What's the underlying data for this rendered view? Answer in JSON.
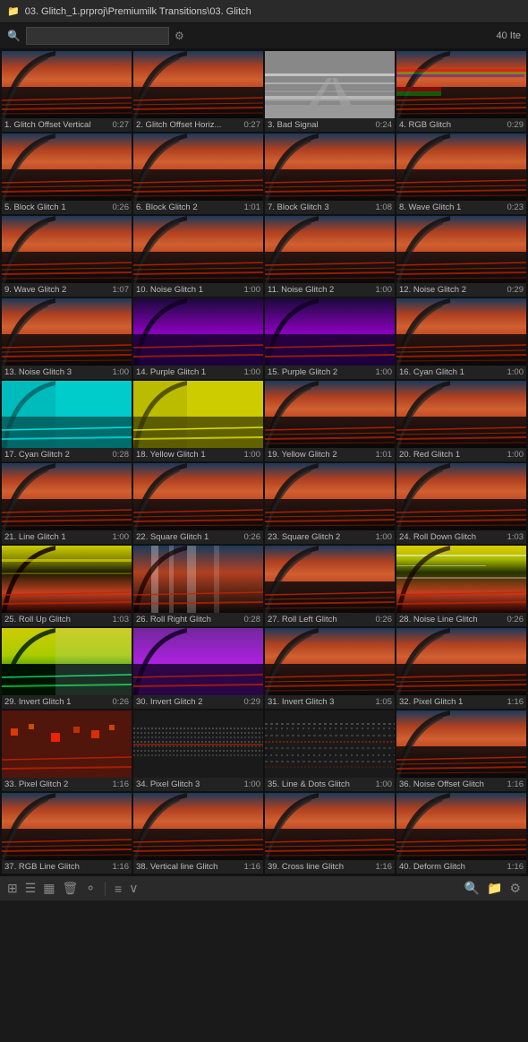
{
  "header": {
    "icon": "📁",
    "title": "03. Glitch_1.prproj\\Premiumilk Transitions\\03. Glitch"
  },
  "search": {
    "placeholder": "",
    "value": ""
  },
  "item_count": "40 Ite",
  "items": [
    {
      "id": 1,
      "name": "1. Glitch Offset Vertical",
      "time": "0:27",
      "type": "base"
    },
    {
      "id": 2,
      "name": "2. Glitch Offset Horiz...",
      "time": "0:27",
      "type": "base"
    },
    {
      "id": 3,
      "name": "3. Bad Signal",
      "time": "0:24",
      "type": "gray"
    },
    {
      "id": 4,
      "name": "4. RGB Glitch",
      "time": "0:29",
      "type": "rgb"
    },
    {
      "id": 5,
      "name": "5. Block Glitch 1",
      "time": "0:26",
      "type": "block"
    },
    {
      "id": 6,
      "name": "6. Block Glitch 2",
      "time": "1:01",
      "type": "block"
    },
    {
      "id": 7,
      "name": "7. Block Glitch 3",
      "time": "1:08",
      "type": "block"
    },
    {
      "id": 8,
      "name": "8. Wave Glitch 1",
      "time": "0:23",
      "type": "wave"
    },
    {
      "id": 9,
      "name": "9. Wave Glitch 2",
      "time": "1:07",
      "type": "wave"
    },
    {
      "id": 10,
      "name": "10. Noise Glitch 1",
      "time": "1:00",
      "type": "noise"
    },
    {
      "id": 11,
      "name": "11. Noise Glitch 2",
      "time": "1:00",
      "type": "noise"
    },
    {
      "id": 12,
      "name": "12. Noise Glitch 2",
      "time": "0:29",
      "type": "noise"
    },
    {
      "id": 13,
      "name": "13. Noise Glitch 3",
      "time": "1:00",
      "type": "noise"
    },
    {
      "id": 14,
      "name": "14. Purple Glitch 1",
      "time": "1:00",
      "type": "purple"
    },
    {
      "id": 15,
      "name": "15. Purple Glitch 2",
      "time": "1:00",
      "type": "purple"
    },
    {
      "id": 16,
      "name": "16. Cyan Glitch 1",
      "time": "1:00",
      "type": "cyan"
    },
    {
      "id": 17,
      "name": "17. Cyan Glitch 2",
      "time": "0:28",
      "type": "cyan-full"
    },
    {
      "id": 18,
      "name": "18. Yellow Glitch 1",
      "time": "1:00",
      "type": "yellow-full"
    },
    {
      "id": 19,
      "name": "19. Yellow Glitch 2",
      "time": "1:01",
      "type": "yellow"
    },
    {
      "id": 20,
      "name": "20. Red Glitch 1",
      "time": "1:00",
      "type": "red"
    },
    {
      "id": 21,
      "name": "21. Line Glitch 1",
      "time": "1:00",
      "type": "line"
    },
    {
      "id": 22,
      "name": "22. Square Glitch 1",
      "time": "0:26",
      "type": "base"
    },
    {
      "id": 23,
      "name": "23. Square Glitch 2",
      "time": "1:00",
      "type": "base"
    },
    {
      "id": 24,
      "name": "24. Roll Down Glitch",
      "time": "1:03",
      "type": "roll"
    },
    {
      "id": 25,
      "name": "25. Roll Up Glitch",
      "time": "1:03",
      "type": "roll-yellow"
    },
    {
      "id": 26,
      "name": "26. Roll Right Glitch",
      "time": "0:28",
      "type": "roll-right"
    },
    {
      "id": 27,
      "name": "27. Roll Left Glitch",
      "time": "0:26",
      "type": "base"
    },
    {
      "id": 28,
      "name": "28. Noise Line Glitch",
      "time": "0:26",
      "type": "noise-roll"
    },
    {
      "id": 29,
      "name": "29. Invert Glitch 1",
      "time": "0:26",
      "type": "invert"
    },
    {
      "id": 30,
      "name": "30. Invert Glitch 2",
      "time": "0:29",
      "type": "purple-full"
    },
    {
      "id": 31,
      "name": "31. Invert Glitch 3",
      "time": "1:05",
      "type": "base"
    },
    {
      "id": 32,
      "name": "32. Pixel Glitch 1",
      "time": "1:16",
      "type": "base"
    },
    {
      "id": 33,
      "name": "33. Pixel Glitch 2",
      "time": "1:16",
      "type": "pixel"
    },
    {
      "id": 34,
      "name": "34. Pixel Glitch 3",
      "time": "1:00",
      "type": "dots-white"
    },
    {
      "id": 35,
      "name": "35. Line & Dots Glitch",
      "time": "1:00",
      "type": "dots-white2"
    },
    {
      "id": 36,
      "name": "36. Noise Offset Glitch",
      "time": "1:16",
      "type": "base"
    },
    {
      "id": 37,
      "name": "37. RGB Line Glitch",
      "time": "1:16",
      "type": "base"
    },
    {
      "id": 38,
      "name": "38. Vertical line Glitch",
      "time": "1:16",
      "type": "base"
    },
    {
      "id": 39,
      "name": "39. Cross line Glitch",
      "time": "1:16",
      "type": "base"
    },
    {
      "id": 40,
      "name": "40. Deform Glitch",
      "time": "1:16",
      "type": "base"
    }
  ],
  "toolbar": {
    "icons": [
      "grid-icon",
      "list-icon",
      "panel-icon",
      "bin-icon",
      "circle-icon",
      "menu-icon",
      "chevron-icon",
      "search-icon",
      "folder-icon",
      "settings-icon"
    ]
  }
}
